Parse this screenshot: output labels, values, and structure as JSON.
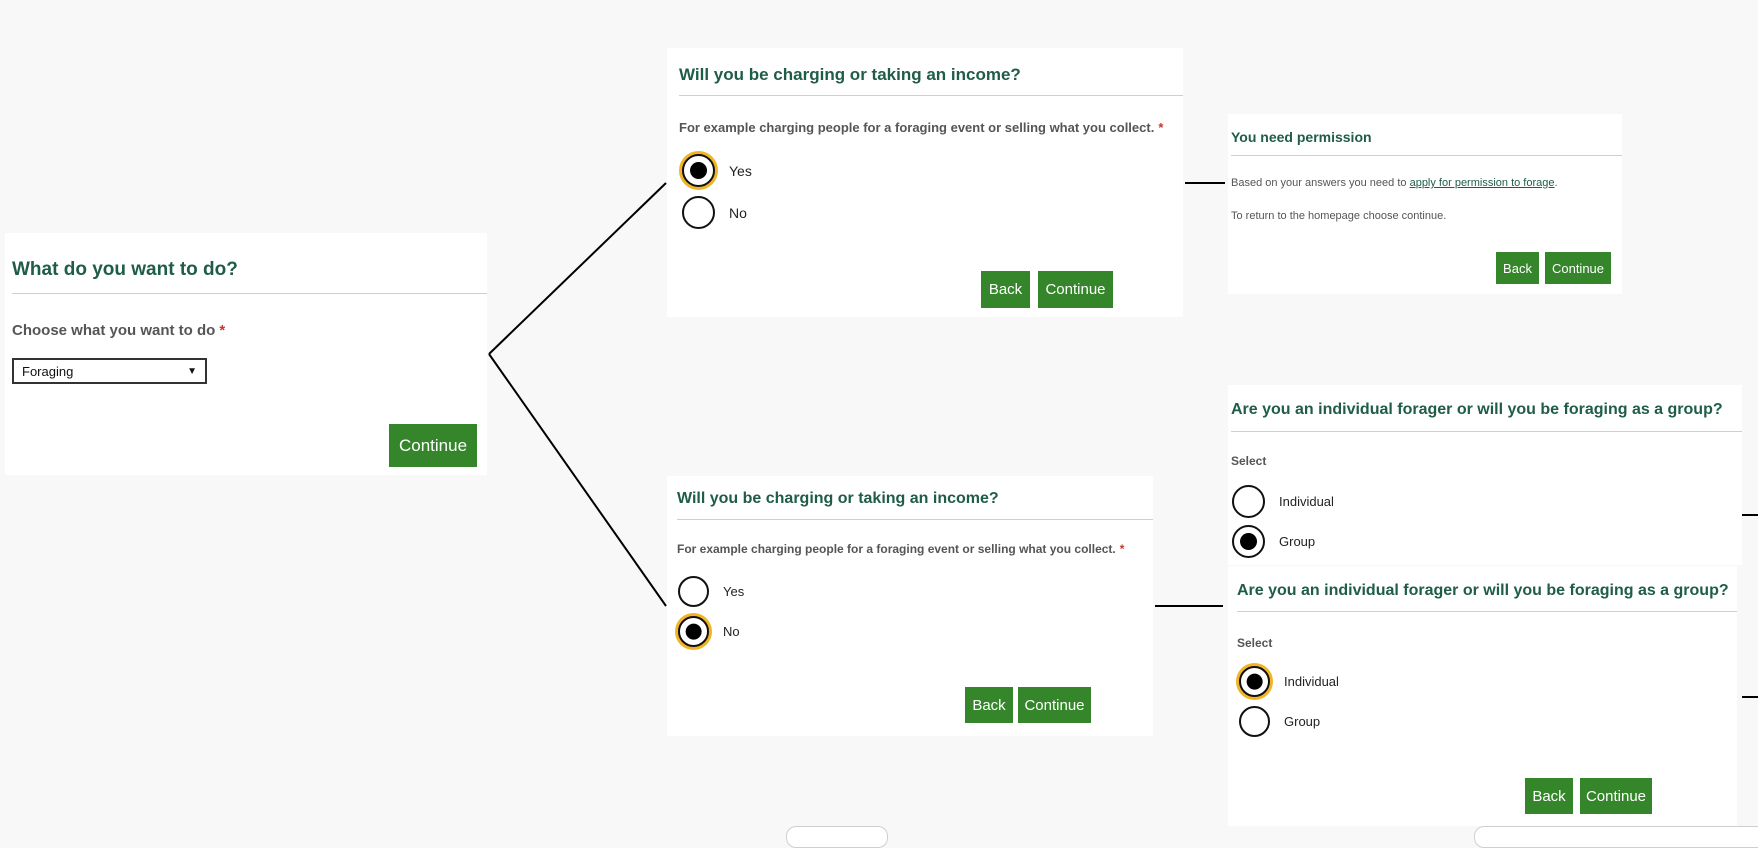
{
  "start": {
    "title": "What do you want to do?",
    "prompt": "Choose what you want to do",
    "required": "*",
    "select_value": "Foraging",
    "continue": "Continue"
  },
  "income_yes": {
    "title": "Will you be charging or taking an income?",
    "prompt": "For example charging people for a foraging event or selling what you collect.",
    "required": "*",
    "options": [
      {
        "label": "Yes",
        "checked": true
      },
      {
        "label": "No",
        "checked": false
      }
    ],
    "back": "Back",
    "continue": "Continue"
  },
  "income_no": {
    "title": "Will you be charging or taking an income?",
    "prompt": "For example charging people for a foraging event or selling what you collect.",
    "required": "*",
    "options": [
      {
        "label": "Yes",
        "checked": false
      },
      {
        "label": "No",
        "checked": true
      }
    ],
    "back": "Back",
    "continue": "Continue"
  },
  "permission": {
    "title": "You need permission",
    "text_before": "Based on your answers you need to",
    "link": "apply for permission to forage",
    "text_after": ".",
    "return_text": "To return to the homepage choose continue.",
    "back": "Back",
    "continue": "Continue"
  },
  "group_selected": {
    "title": "Are you an individual forager or will you be foraging as a group?",
    "prompt": "Select",
    "options": [
      {
        "label": "Individual",
        "checked": false
      },
      {
        "label": "Group",
        "checked": true
      }
    ]
  },
  "individual_selected": {
    "title": "Are you an individual forager or will you be foraging as a group?",
    "prompt": "Select",
    "options": [
      {
        "label": "Individual",
        "checked": true
      },
      {
        "label": "Group",
        "checked": false
      }
    ],
    "back": "Back",
    "continue": "Continue"
  },
  "colors": {
    "heading": "#1f5c4a",
    "button": "#35862b",
    "focus": "#f0b429",
    "required": "#c0392b"
  }
}
